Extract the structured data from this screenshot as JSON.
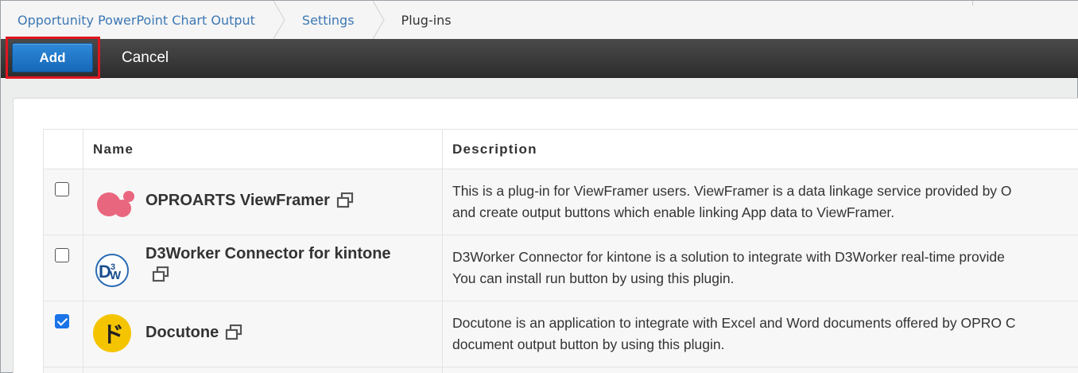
{
  "breadcrumb": {
    "items": [
      {
        "label": "Opportunity PowerPoint Chart Output"
      },
      {
        "label": "Settings"
      },
      {
        "label": "Plug-ins"
      }
    ]
  },
  "toolbar": {
    "add_label": "Add",
    "cancel_label": "Cancel"
  },
  "table": {
    "headers": {
      "name": "Name",
      "description": "Description"
    },
    "rows": [
      {
        "name": "OPROARTS ViewFramer",
        "icon": "viewframer-logo-icon",
        "checked": false,
        "desc_line1": "This is a plug-in for ViewFramer users. ViewFramer is a data linkage service provided by O",
        "desc_line2": "and create output buttons which enable linking App data to ViewFramer."
      },
      {
        "name": "D3Worker Connector for kintone",
        "icon": "d3worker-logo-icon",
        "checked": false,
        "desc_line1": "D3Worker Connector for kintone is a solution to integrate with D3Worker real-time provide",
        "desc_line2": "You can install run button by using this plugin."
      },
      {
        "name": "Docutone",
        "icon": "docutone-logo-icon",
        "checked": true,
        "desc_line1": "Docutone is an application to integrate with Excel and Word documents offered by OPRO C",
        "desc_line2": "document output button by using this plugin."
      }
    ]
  },
  "colors": {
    "link": "#3d78b5",
    "add_button": "#1f78c8",
    "toolbar": "#333333",
    "highlight": "#e0161f",
    "checkbox_checked": "#1a73e8"
  }
}
